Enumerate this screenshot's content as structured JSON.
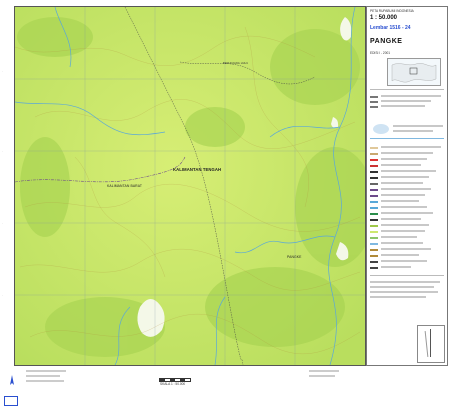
{
  "header": {
    "series": "PETA RUPABUMI INDONESIA",
    "scale": "1 : 50.000",
    "sheet_number": "Lembar 1516 - 24",
    "sheet_name": "PANGKE",
    "edition": "EDISI I - 2001"
  },
  "places": {
    "kalimantan_tengah": "KALIMANTAN TENGAH",
    "kalimantan_barat": "KALIMANTAN BARAT",
    "pangke": "PANGKE",
    "berunjang_hulu": "BERUNJANG HULU"
  },
  "bottom": {
    "scale_label": "SKALA 1 : 50.000"
  },
  "colors": {
    "forest_light": "#cbe86c",
    "forest_dark": "#9fcf4a",
    "river": "#5aa8d8",
    "contour": "#b08a3a",
    "grid": "#7a8ea8",
    "boundary": "#6d4a8a"
  }
}
